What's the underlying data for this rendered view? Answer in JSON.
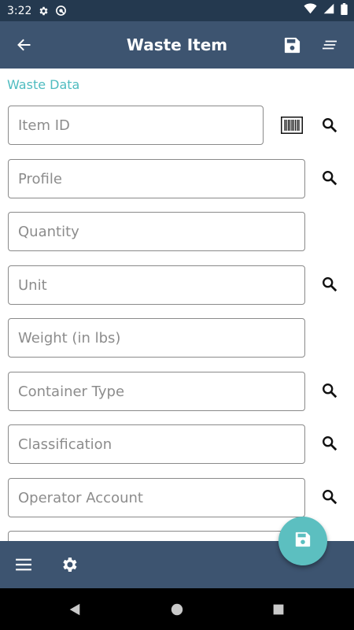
{
  "status_bar": {
    "time": "3:22",
    "icons": [
      "gear-icon",
      "sync-icon",
      "wifi-icon",
      "signal-icon",
      "battery-icon"
    ]
  },
  "app_bar": {
    "title": "Waste Item",
    "icons": [
      "back-arrow-icon",
      "save-icon",
      "sort-icon"
    ]
  },
  "form": {
    "section_label": "Waste Data",
    "fields": [
      {
        "placeholder": "Item ID",
        "value": "",
        "actions": [
          "barcode-icon",
          "search-icon"
        ]
      },
      {
        "placeholder": "Profile",
        "value": "",
        "actions": [
          "search-icon"
        ]
      },
      {
        "placeholder": "Quantity",
        "value": "",
        "actions": []
      },
      {
        "placeholder": "Unit",
        "value": "",
        "actions": [
          "search-icon"
        ]
      },
      {
        "placeholder": "Weight (in lbs)",
        "value": "",
        "actions": []
      },
      {
        "placeholder": "Container Type",
        "value": "",
        "actions": [
          "search-icon"
        ]
      },
      {
        "placeholder": "Classification",
        "value": "",
        "actions": [
          "search-icon"
        ]
      },
      {
        "placeholder": "Operator Account",
        "value": "",
        "actions": [
          "search-icon"
        ]
      }
    ]
  },
  "bottom_bar": {
    "icons": [
      "menu-icon",
      "settings-icon",
      "save-icon"
    ]
  },
  "colors": {
    "status_bar": "#24394f",
    "app_bar": "#3d5470",
    "accent": "#4fbcc0",
    "fab": "#5cbfc0"
  }
}
